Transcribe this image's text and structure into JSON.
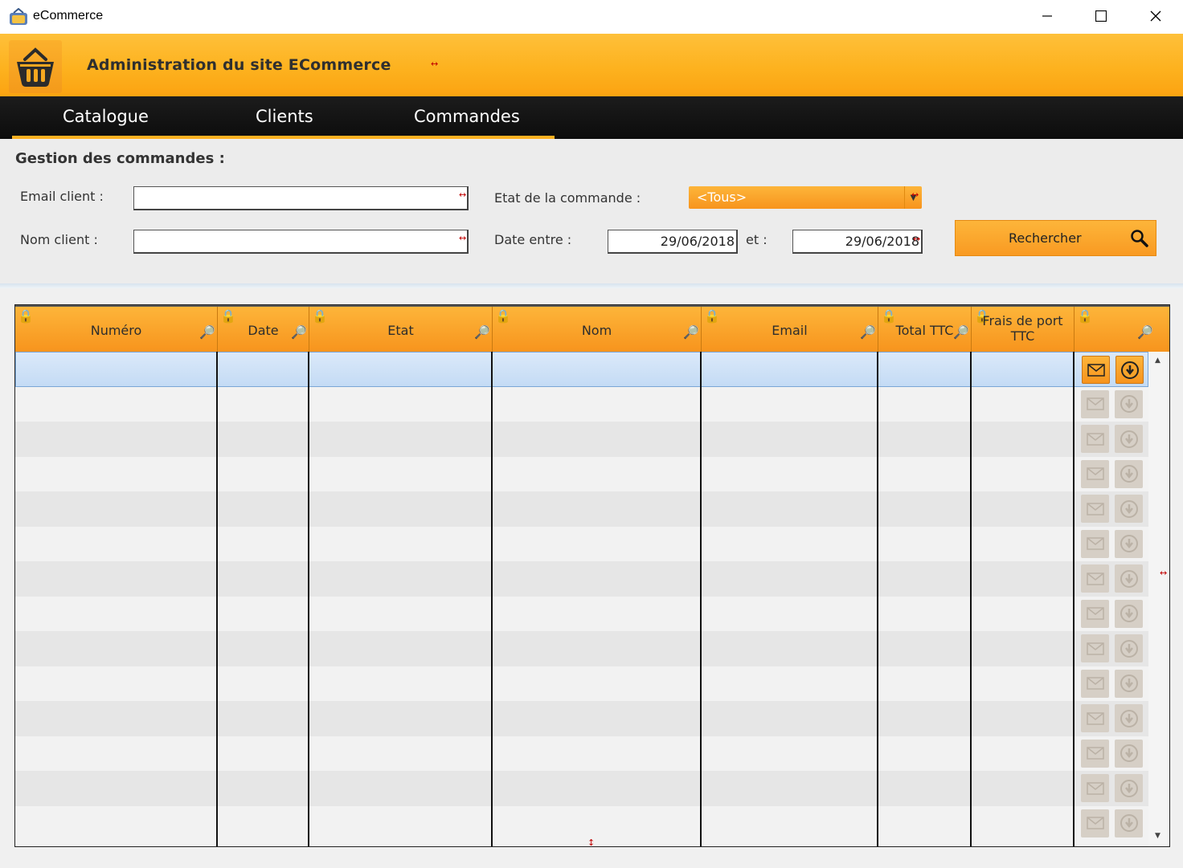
{
  "window": {
    "title": "eCommerce"
  },
  "header": {
    "title": "Administration du site ECommerce"
  },
  "nav": {
    "tabs": [
      {
        "label": "Catalogue"
      },
      {
        "label": "Clients"
      },
      {
        "label": "Commandes"
      }
    ],
    "active_tab": "Commandes"
  },
  "filters": {
    "section_title": "Gestion des commandes :",
    "email_label": "Email client :",
    "email_value": "",
    "nom_label": "Nom client :",
    "nom_value": "",
    "etat_label": "Etat de la commande :",
    "etat_value": "<Tous>",
    "date_label": "Date entre :",
    "date_from": "29/06/2018",
    "et_label": "et :",
    "date_to": "29/06/2018",
    "search_label": "Rechercher"
  },
  "table": {
    "columns": [
      {
        "label": "Numéro"
      },
      {
        "label": "Date"
      },
      {
        "label": "Etat"
      },
      {
        "label": "Nom"
      },
      {
        "label": "Email"
      },
      {
        "label": "Total TTC"
      },
      {
        "label": "Frais de port TTC"
      },
      {
        "label": ""
      }
    ],
    "row_count": 14
  },
  "colors": {
    "accent": "#fbb021",
    "header_text": "#2f2f2f",
    "nav_bg": "#111111",
    "selection": "#c4dbf5"
  },
  "icons": {
    "app": "ecommerce-app-icon",
    "logo": "basket-icon",
    "search": "magnifier-icon",
    "mail": "envelope-icon",
    "download": "download-circle-icon"
  }
}
